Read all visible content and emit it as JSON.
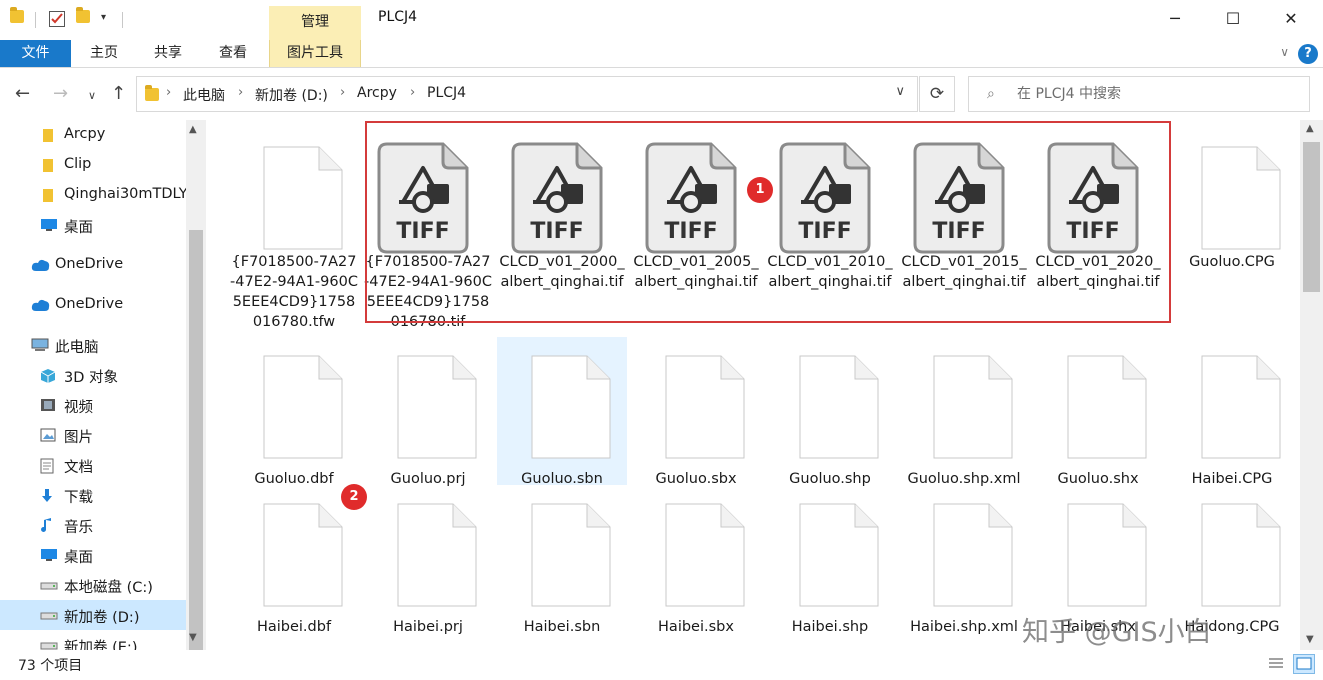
{
  "title_bar": {
    "manage_tab": "管理",
    "window_title": "PLCJ4",
    "minimize": "─",
    "maximize": "☐",
    "close": "✕"
  },
  "ribbon": {
    "tabs": [
      "文件",
      "主页",
      "共享",
      "查看",
      "图片工具"
    ],
    "help": "?"
  },
  "address_bar": {
    "segments": [
      "此电脑",
      "新加卷 (D:)",
      "Arcpy",
      "PLCJ4"
    ],
    "search_placeholder": "在 PLCJ4 中搜索"
  },
  "sidebar": {
    "items": [
      {
        "label": "Arcpy",
        "icon": "folder-icon"
      },
      {
        "label": "Clip",
        "icon": "folder-icon"
      },
      {
        "label": "Qinghai30mTDLY",
        "icon": "folder-icon"
      },
      {
        "label": "桌面",
        "icon": "desktop-icon"
      },
      {
        "label": "OneDrive",
        "icon": "cloud-icon"
      },
      {
        "label": "OneDrive",
        "icon": "cloud-icon"
      },
      {
        "label": "此电脑",
        "icon": "computer-icon"
      },
      {
        "label": "3D 对象",
        "icon": "cube-icon"
      },
      {
        "label": "视频",
        "icon": "video-icon"
      },
      {
        "label": "图片",
        "icon": "picture-icon"
      },
      {
        "label": "文档",
        "icon": "document-icon"
      },
      {
        "label": "下载",
        "icon": "download-icon"
      },
      {
        "label": "音乐",
        "icon": "music-icon"
      },
      {
        "label": "桌面",
        "icon": "desktop-icon"
      },
      {
        "label": "本地磁盘 (C:)",
        "icon": "drive-icon"
      },
      {
        "label": "新加卷 (D:)",
        "icon": "drive-icon"
      },
      {
        "label": "新加卷 (E:)",
        "icon": "drive-icon"
      }
    ]
  },
  "files": {
    "row1": [
      {
        "name": "{F7018500-7A27-47E2-94A1-960C5EEE4CD9}1758016780.tfw",
        "kind": "generic"
      },
      {
        "name": "{F7018500-7A27-47E2-94A1-960C5EEE4CD9}1758016780.tif",
        "kind": "tiff"
      },
      {
        "name": "CLCD_v01_2000_albert_qinghai.tif",
        "kind": "tiff"
      },
      {
        "name": "CLCD_v01_2005_albert_qinghai.tif",
        "kind": "tiff"
      },
      {
        "name": "CLCD_v01_2010_albert_qinghai.tif",
        "kind": "tiff"
      },
      {
        "name": "CLCD_v01_2015_albert_qinghai.tif",
        "kind": "tiff"
      },
      {
        "name": "CLCD_v01_2020_albert_qinghai.tif",
        "kind": "tiff"
      },
      {
        "name": "Guoluo.CPG",
        "kind": "generic"
      }
    ],
    "row2": [
      "Guoluo.dbf",
      "Guoluo.prj",
      "Guoluo.sbn",
      "Guoluo.sbx",
      "Guoluo.shp",
      "Guoluo.shp.xml",
      "Guoluo.shx",
      "Haibei.CPG"
    ],
    "row3": [
      "Haibei.dbf",
      "Haibei.prj",
      "Haibei.sbn",
      "Haibei.sbx",
      "Haibei.shp",
      "Haibei.shp.xml",
      "Haibei.shx",
      "Haidong.CPG"
    ]
  },
  "tiff_label": "TIFF",
  "badges": [
    "1",
    "2"
  ],
  "status": {
    "item_count": "73 个项目"
  },
  "watermark": "知乎 @GIS小白",
  "colors": {
    "accent": "#1979ca",
    "picture_tools_tab": "#fbeeb5",
    "selection": "#cce8ff",
    "annotation_red": "#d43b3b"
  }
}
